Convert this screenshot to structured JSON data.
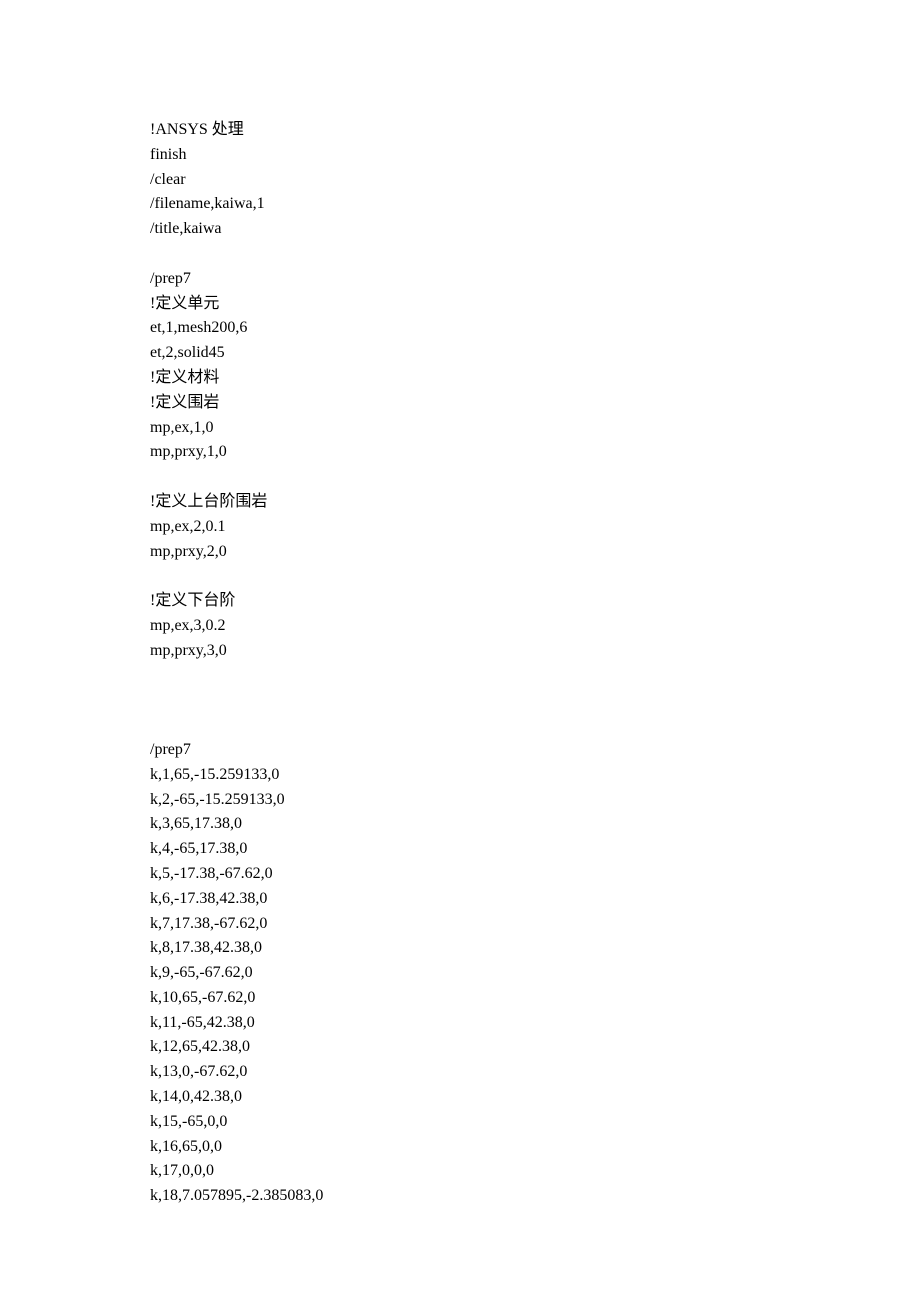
{
  "lines": [
    "!ANSYS 处理",
    "finish",
    "/clear",
    "/filename,kaiwa,1",
    "/title,kaiwa",
    "",
    "/prep7",
    "!定义单元",
    "et,1,mesh200,6",
    "et,2,solid45",
    "!定义材料",
    "!定义围岩",
    "mp,ex,1,0",
    "mp,prxy,1,0",
    "",
    "!定义上台阶围岩",
    "mp,ex,2,0.1",
    "mp,prxy,2,0",
    "",
    "!定义下台阶",
    "mp,ex,3,0.2",
    "mp,prxy,3,0",
    "",
    "",
    "",
    "/prep7",
    "k,1,65,-15.259133,0",
    "k,2,-65,-15.259133,0",
    "k,3,65,17.38,0",
    "k,4,-65,17.38,0",
    "k,5,-17.38,-67.62,0",
    "k,6,-17.38,42.38,0",
    "k,7,17.38,-67.62,0",
    "k,8,17.38,42.38,0",
    "k,9,-65,-67.62,0",
    "k,10,65,-67.62,0",
    "k,11,-65,42.38,0",
    "k,12,65,42.38,0",
    "k,13,0,-67.62,0",
    "k,14,0,42.38,0",
    "k,15,-65,0,0",
    "k,16,65,0,0",
    "k,17,0,0,0",
    "k,18,7.057895,-2.385083,0"
  ]
}
